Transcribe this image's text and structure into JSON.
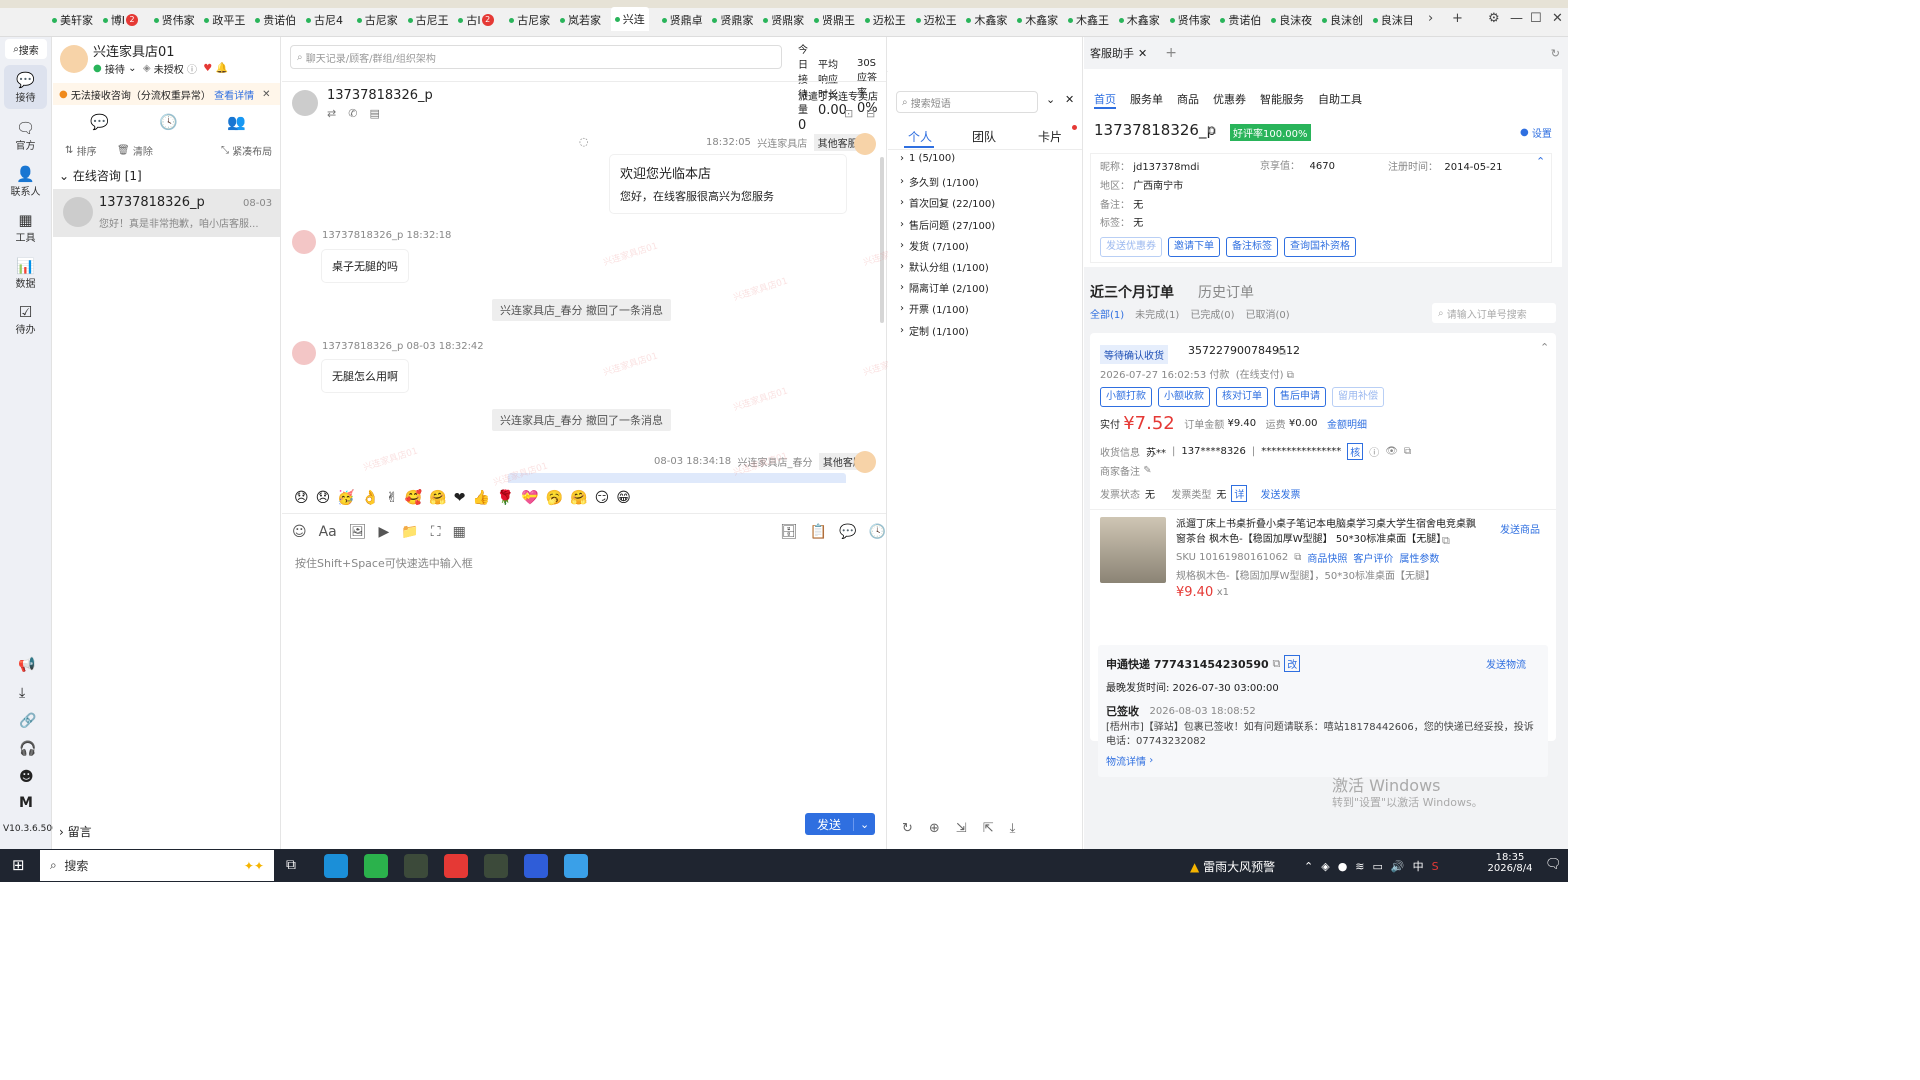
{
  "tabs": [
    "美轩家",
    "博I",
    "贤伟家",
    "政平王",
    "贵诺伯",
    "古尼4",
    "古尼家",
    "古尼王",
    "古I",
    "古尼家",
    "岚若家",
    "兴连",
    "贤鼎卓",
    "贤鼎家",
    "贤鼎家",
    "贤鼎王",
    "迈松王",
    "迈松王",
    "木鑫家",
    "木鑫家",
    "木鑫王",
    "木鑫家",
    "贤伟家",
    "贵诺伯",
    "良沫夜",
    "良沫创",
    "良沫目"
  ],
  "tab_badges": {
    "1": "2",
    "8": "2"
  },
  "rail": {
    "search": "搜索",
    "items": [
      "接待",
      "官方",
      "联系人",
      "工具",
      "数据",
      "待办"
    ],
    "version": "V10.3.6.500"
  },
  "shop": {
    "name": "兴连家具店01",
    "status": "接待",
    "auth": "未授权"
  },
  "notice": {
    "text": "无法接收咨询（分流权重异常）",
    "link": "查看详情"
  },
  "sess_tools": [
    "排序",
    "清除",
    "紧凑布局"
  ],
  "group": "在线咨询 [1]",
  "session": {
    "name": "13737818326_p",
    "date": "08-03",
    "preview": "您好！真是非常抱歉，咱小店客服..."
  },
  "leave_msg": "留言",
  "search_placeholder": "聊天记录/顾客/群组/组织架构",
  "stats": [
    {
      "label": "今日接待量",
      "value": "0"
    },
    {
      "label": "平均响应时长",
      "value": "0.00"
    },
    {
      "label": "30S应答率",
      "value": "0%"
    },
    {
      "label": "今日促成下单金额",
      "value": "0.00"
    }
  ],
  "chat": {
    "customer": "13737818326_p",
    "dispatch": "派遣丁兴连专卖店",
    "m1_time": "18:32:05",
    "m1_sender": "兴连家具店",
    "m1_tag": "其他客服",
    "m1_title": "欢迎您光临本店",
    "m1_body": "您好，在线客服很高兴为您服务",
    "m2_head": "13737818326_p  18:32:18",
    "m2_body": "桌子无腿的吗",
    "sys1": "兴连家具店_春分 撤回了一条消息",
    "m3_head": "13737818326_p  08-03 18:32:42",
    "m3_body": "无腿怎么用啊",
    "sys2": "兴连家具店_春分 撤回了一条消息",
    "m4_time": "08-03 18:34:18",
    "m4_sender": "兴连家具店_春分",
    "m4_tag": "其他客服",
    "input_placeholder": "按住Shift+Space可快速选中输入框",
    "send": "发送",
    "watermark": "兴连家具店01"
  },
  "emojis": [
    "😞",
    "😞",
    "🥳",
    "👌",
    "✌",
    "🥰",
    "🤗",
    "❤",
    "👍",
    "🌹",
    "💝",
    "🥱",
    "🤗",
    "😏",
    "😁"
  ],
  "quick": {
    "placeholder": "搜索短语",
    "tabs": [
      "个人",
      "团队",
      "卡片"
    ],
    "groups": [
      "1 (5/100)",
      "多久到 (1/100)",
      "首次回复 (22/100)",
      "售后问题 (27/100)",
      "发货 (7/100)",
      "默认分组 (1/100)",
      "隔离订单 (2/100)",
      "开票 (1/100)",
      "定制 (1/100)"
    ]
  },
  "assist": {
    "tab": "客服助手",
    "nav": [
      "首页",
      "服务单",
      "商品",
      "优惠券",
      "智能服务",
      "自助工具"
    ],
    "customer": "13737818326_p",
    "rating": "好评率100.00%",
    "settings": "设置",
    "nick_label": "昵称：",
    "nick": "jd137378mdi",
    "jx_label": "京享值：",
    "jx": "4670",
    "reg_label": "注册时间：",
    "reg": "2014-05-21",
    "area_label": "地区：",
    "area": "广西南宁市",
    "note_label": "备注：",
    "note": "无",
    "tag_label": "标签：",
    "tag": "无",
    "actions": [
      "发送优惠券",
      "邀请下单",
      "备注标签",
      "查询国补资格"
    ],
    "order_tabs": [
      "近三个月订单",
      "历史订单"
    ],
    "order_filters": [
      "全部(1)",
      "未完成(1)",
      "已完成(0)",
      "已取消(0)"
    ],
    "order_search": "请输入订单号搜索",
    "order": {
      "status": "等待确认收货",
      "id": "3572279007849512",
      "time": "2026-07-27 16:02:53  付款",
      "pay": "(在线支付)",
      "btns": [
        "小额打款",
        "小额收款",
        "核对订单",
        "售后申请",
        "留用补偿"
      ],
      "paid_label": "实付",
      "paid": "¥7.52",
      "total_label": "订单金额",
      "total": "¥9.40",
      "ship_label": "运费",
      "ship": "¥0.00",
      "detail": "金额明细",
      "recv_label": "收货信息",
      "recv_name": "苏**",
      "recv_phone": "137****8326",
      "recv_addr": "****************",
      "check": "核",
      "merchant_note": "商家备注",
      "inv_label": "发票状态",
      "inv": "无",
      "inv_type_label": "发票类型",
      "inv_type": "无",
      "inv_detail": "详",
      "inv_send": "发送发票",
      "goods_title": "派遛丁床上书桌折叠小桌子笔记本电脑桌学习桌大学生宿舍电竞桌飘窗茶台 枫木色-【稳固加厚W型腿】 50*30标准桌面【无腿】",
      "send_goods": "发送商品",
      "sku": "SKU 10161980161062",
      "sku_links": [
        "商品快照",
        "客户评价",
        "属性参数"
      ],
      "spec": "规格枫木色-【稳固加厚W型腿】，50*30标准桌面【无腿】",
      "price": "¥9.40",
      "qty": "x1",
      "express": "申通快递 777431454230590",
      "express_edit": "改",
      "send_express": "发送物流",
      "latest_ship": "最晚发货时间:   2026-07-30 03:00:00",
      "signed": "已签收",
      "signed_time": "2026-08-03 18:08:52",
      "track": "[梧州市]【驿站】包裹已签收！如有问题请联系：嘻站18178442606，您的快递已经妥投，投诉电话：07743232082",
      "track_link": "物流详情"
    },
    "activate1": "激活 Windows",
    "activate2": "转到\"设置\"以激活 Windows。"
  },
  "taskbar": {
    "search": "搜索",
    "weather": "雷雨大风预警",
    "time": "18:35",
    "date": "2026/8/4",
    "ime": "中"
  },
  "colors": {
    "accent": "#2f6fe0",
    "price": "#e53935",
    "green": "#29b45a"
  }
}
